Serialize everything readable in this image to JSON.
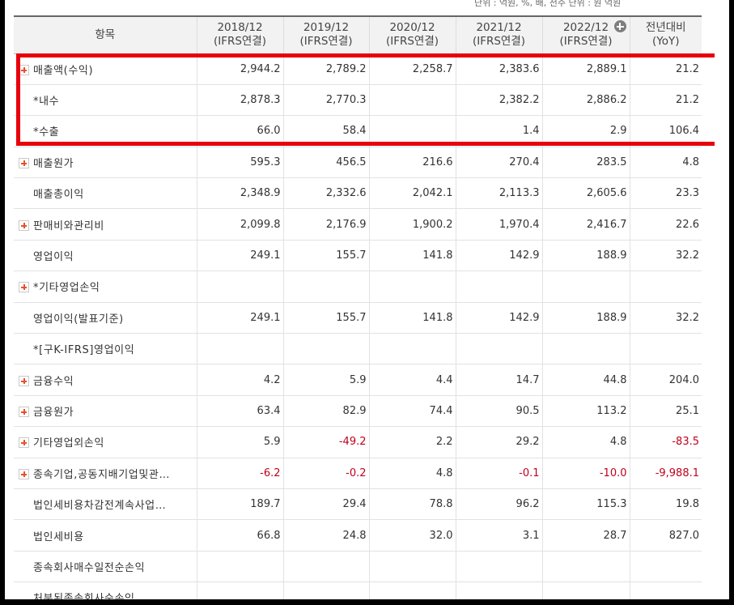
{
  "top_note": "단위 : 억원, %, 배, 천주    단위 : 원 억원",
  "header": {
    "item_label": "항목",
    "periods": [
      {
        "year": "2018/12",
        "basis": "(IFRS연결)"
      },
      {
        "year": "2019/12",
        "basis": "(IFRS연결)"
      },
      {
        "year": "2020/12",
        "basis": "(IFRS연결)"
      },
      {
        "year": "2021/12",
        "basis": "(IFRS연결)"
      },
      {
        "year": "2022/12",
        "basis": "(IFRS연결)"
      }
    ],
    "yoy_label": "전년대비",
    "yoy_sub": "(YoY)"
  },
  "rows": [
    {
      "name": "매출액(수익)",
      "icon": "expand",
      "values": [
        "2,944.2",
        "2,789.2",
        "2,258.7",
        "2,383.6",
        "2,889.1",
        "21.2"
      ]
    },
    {
      "name": "*내수",
      "icon": "none-sub",
      "values": [
        "2,878.3",
        "2,770.3",
        "",
        "2,382.2",
        "2,886.2",
        "21.2"
      ]
    },
    {
      "name": "*수출",
      "icon": "none-sub",
      "values": [
        "66.0",
        "58.4",
        "",
        "1.4",
        "2.9",
        "106.4"
      ]
    },
    {
      "name": "매출원가",
      "icon": "expand",
      "values": [
        "595.3",
        "456.5",
        "216.6",
        "270.4",
        "283.5",
        "4.8"
      ]
    },
    {
      "name": "매출총이익",
      "icon": "none",
      "values": [
        "2,348.9",
        "2,332.6",
        "2,042.1",
        "2,113.3",
        "2,605.6",
        "23.3"
      ]
    },
    {
      "name": "판매비와관리비",
      "icon": "expand",
      "values": [
        "2,099.8",
        "2,176.9",
        "1,900.2",
        "1,970.4",
        "2,416.7",
        "22.6"
      ]
    },
    {
      "name": "영업이익",
      "icon": "none",
      "values": [
        "249.1",
        "155.7",
        "141.8",
        "142.9",
        "188.9",
        "32.2"
      ]
    },
    {
      "name": "*기타영업손익",
      "icon": "expand",
      "values": [
        "",
        "",
        "",
        "",
        "",
        ""
      ]
    },
    {
      "name": "영업이익(발표기준)",
      "icon": "none",
      "values": [
        "249.1",
        "155.7",
        "141.8",
        "142.9",
        "188.9",
        "32.2"
      ]
    },
    {
      "name": "*[구K-IFRS]영업이익",
      "icon": "none",
      "values": [
        "",
        "",
        "",
        "",
        "",
        ""
      ]
    },
    {
      "name": "금융수익",
      "icon": "expand",
      "values": [
        "4.2",
        "5.9",
        "4.4",
        "14.7",
        "44.8",
        "204.0"
      ]
    },
    {
      "name": "금융원가",
      "icon": "expand",
      "values": [
        "63.4",
        "82.9",
        "74.4",
        "90.5",
        "113.2",
        "25.1"
      ]
    },
    {
      "name": "기타영업외손익",
      "icon": "expand",
      "values": [
        "5.9",
        "-49.2",
        "2.2",
        "29.2",
        "4.8",
        "-83.5"
      ]
    },
    {
      "name": "종속기업,공동지배기업및관…",
      "icon": "expand",
      "values": [
        "-6.2",
        "-0.2",
        "4.8",
        "-0.1",
        "-10.0",
        "-9,988.1"
      ]
    },
    {
      "name": "법인세비용차감전계속사업…",
      "icon": "none",
      "values": [
        "189.7",
        "29.4",
        "78.8",
        "96.2",
        "115.3",
        "19.8"
      ]
    },
    {
      "name": "법인세비용",
      "icon": "none",
      "values": [
        "66.8",
        "24.8",
        "32.0",
        "3.1",
        "28.7",
        "827.0"
      ]
    },
    {
      "name": "종속회사매수일전순손익",
      "icon": "none",
      "values": [
        "",
        "",
        "",
        "",
        "",
        ""
      ]
    },
    {
      "name": "처분된종속회사순손익",
      "icon": "none",
      "values": [
        "",
        "",
        "",
        "",
        "",
        ""
      ]
    }
  ],
  "colors": {
    "highlight": "#e8000d",
    "negative": "#c0001c",
    "expand_icon": "#e8502c"
  }
}
